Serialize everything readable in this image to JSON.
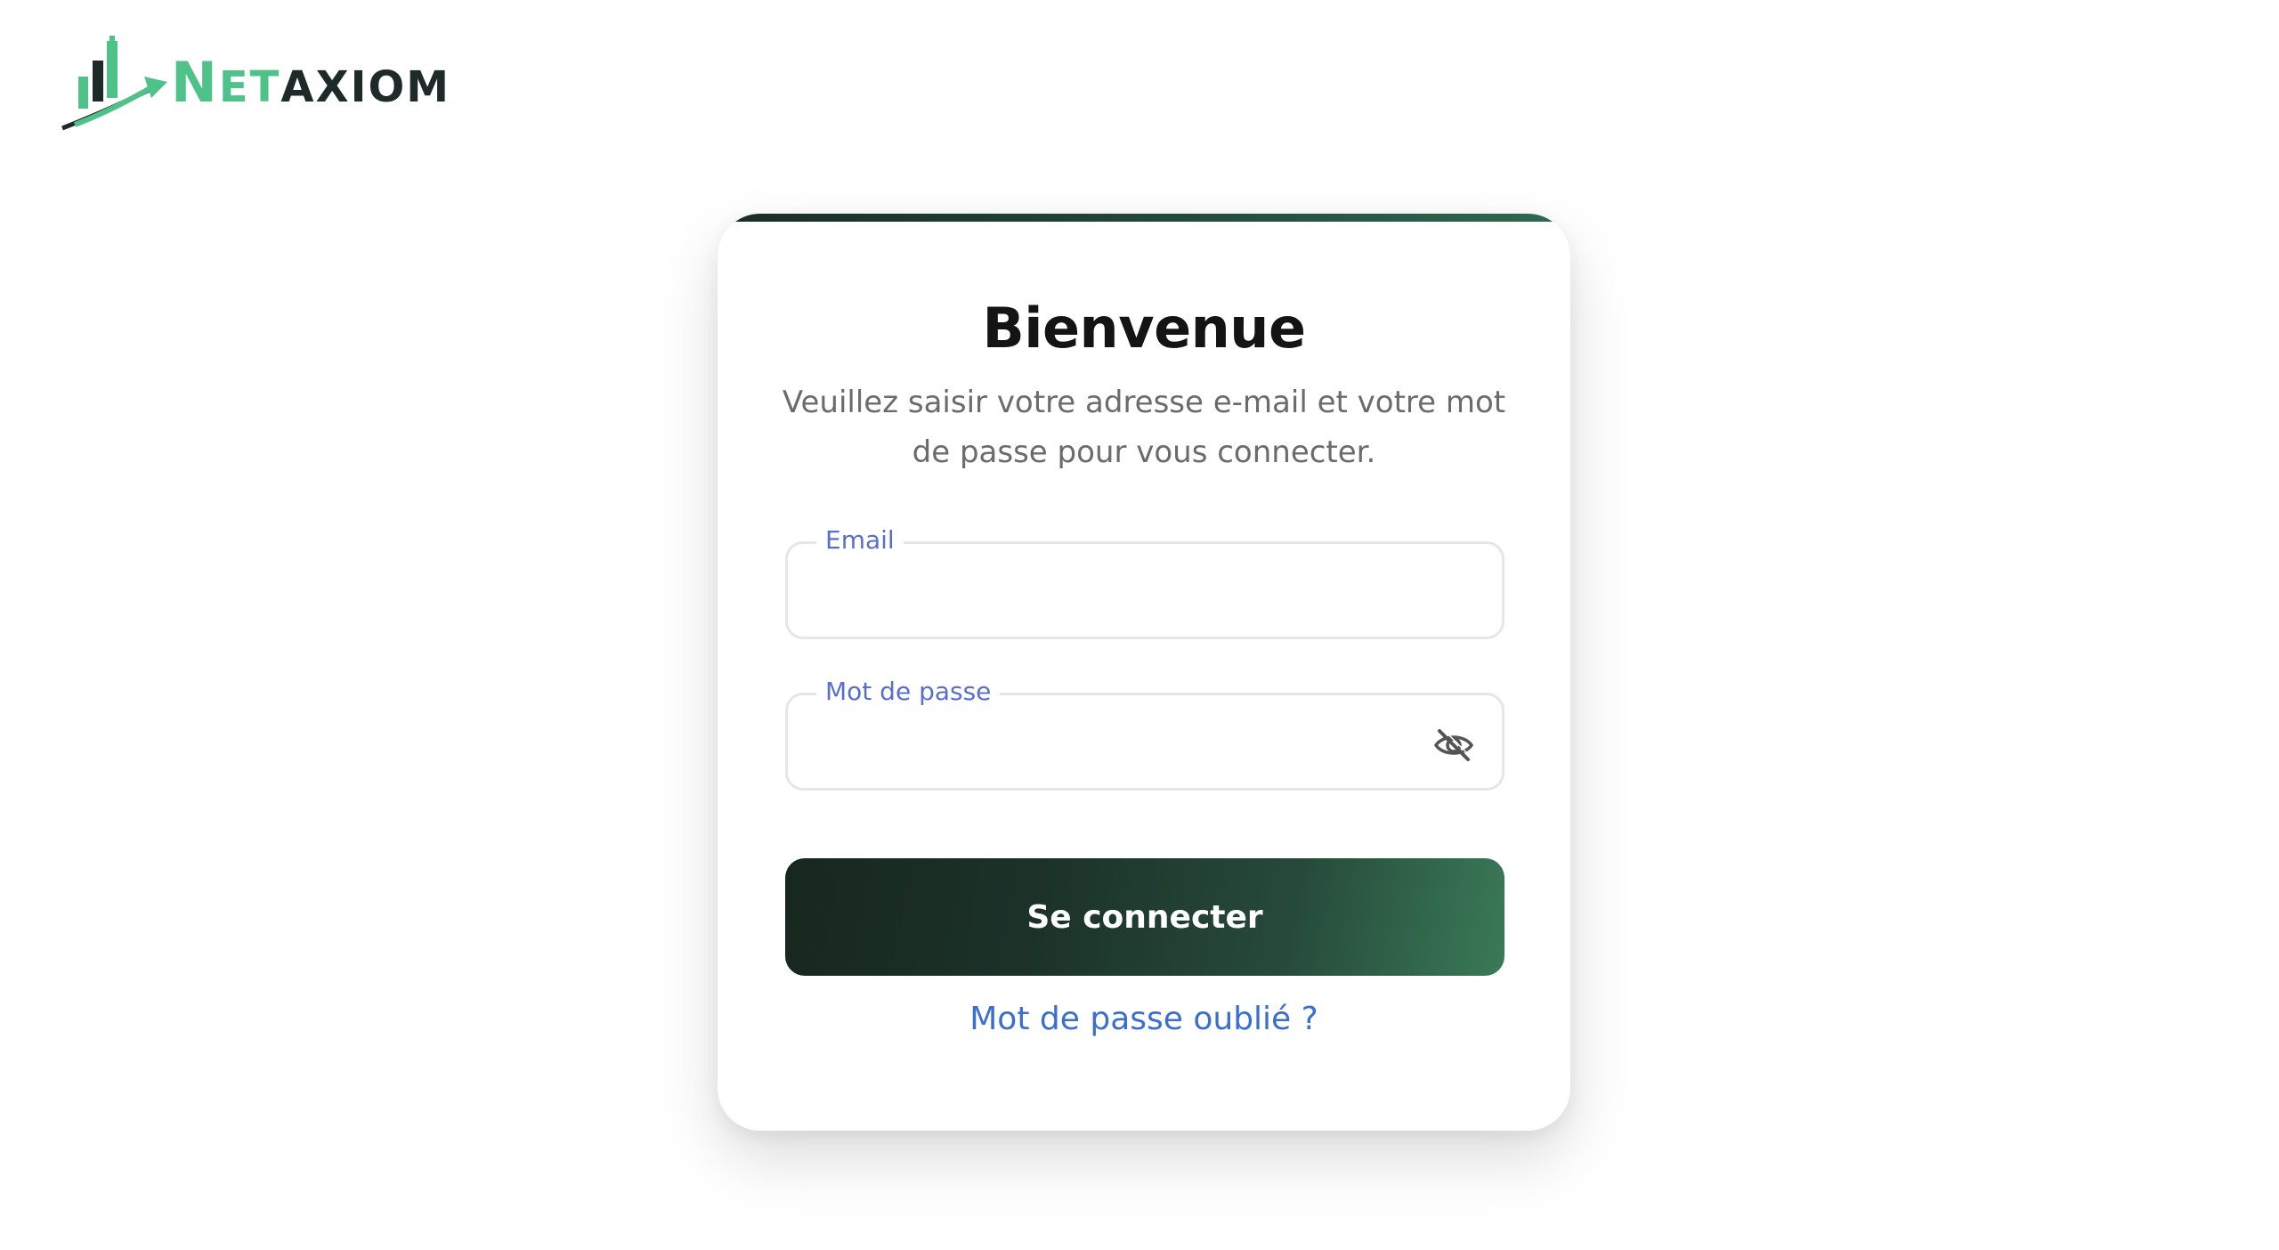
{
  "brand": {
    "logo_initial_n": "N",
    "logo_et": "ET",
    "logo_a": "A",
    "logo_xiom": "XIOM",
    "green": "#4fc28a",
    "dark": "#1d2a28"
  },
  "login": {
    "title": "Bienvenue",
    "subtitle": "Veuillez saisir votre adresse e-mail et votre mot de passe pour vous connecter.",
    "email_label": "Email",
    "email_value": "",
    "password_label": "Mot de passe",
    "password_value": "",
    "password_toggle_icon": "eye-slash-icon",
    "submit_label": "Se connecter",
    "forgot_label": "Mot de passe oublié ?",
    "accent_color": "#1c3229",
    "link_color": "#3a6fcf",
    "label_color": "#5a6fc7"
  }
}
